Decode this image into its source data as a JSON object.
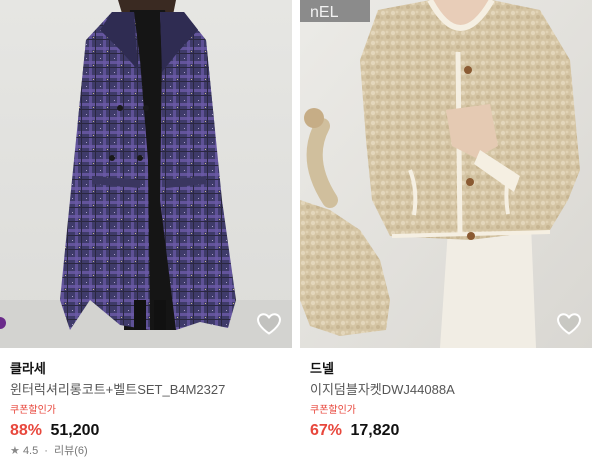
{
  "products": [
    {
      "brand": "클라세",
      "title": "윈터럭셔리롱코트+벨트SET_B4M2327",
      "coupon_label": "쿠폰할인가",
      "discount": "88%",
      "price": "51,200",
      "rating": "4.5",
      "reviews": "리뷰(6)",
      "wishlist_icon": "heart-outline-icon"
    },
    {
      "brand": "드넬",
      "title": "이지덤블자켓DWJ44088A",
      "coupon_label": "쿠폰할인가",
      "discount": "67%",
      "price": "17,820",
      "wishlist_icon": "heart-outline-icon"
    }
  ],
  "colors": {
    "discount": "#e8473c",
    "coat_plaid": "#3e3a6e",
    "jacket": "#d6c6a6"
  }
}
